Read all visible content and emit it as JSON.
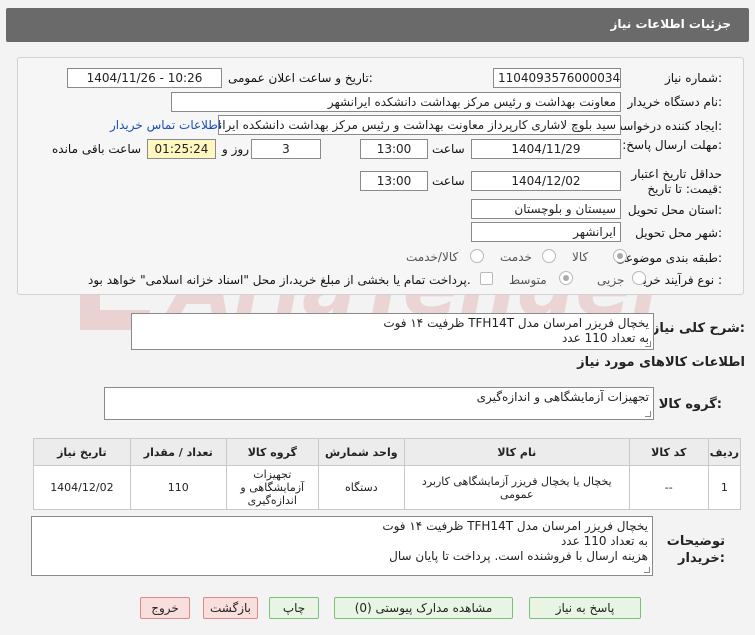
{
  "header": {
    "title": "جزئیات اطلاعات نیاز"
  },
  "form": {
    "need_number_label": "شماره نیاز:",
    "need_number": "1104093576000034",
    "announce_label": "تاریخ و ساعت اعلان عمومی:",
    "announce_value": "1404/11/26 - 10:26",
    "buyer_org_label": "نام دستگاه خریدار:",
    "buyer_org": "معاونت بهداشت و رئیس مرکز بهداشت دانشکده ایرانشهر",
    "creator_label": "ایجاد کننده درخواست:",
    "creator": "سید بلوچ لاشاری کارپرداز معاونت بهداشت و رئیس مرکز بهداشت دانشکده ایرانشهر",
    "contact_link": "اطلاعات تماس خریدار",
    "deadline_label": "مهلت ارسال پاسخ: تا تاریخ:",
    "deadline_date": "1404/11/29",
    "time_label": "ساعت",
    "deadline_time": "13:00",
    "days_value": "3",
    "days_label": "روز و",
    "remaining_time": "01:25:24",
    "remaining_label": "ساعت باقی مانده",
    "min_validity_label": "حداقل تاریخ اعتبار قیمت: تا تاریخ:",
    "validity_date": "1404/12/02",
    "validity_time": "13:00",
    "province_label": "استان محل تحویل:",
    "province": "سیستان و بلوچستان",
    "city_label": "شهر محل تحویل:",
    "city": "ایرانشهر",
    "category_label": "طبقه بندی موضوعی:",
    "category_options": [
      "کالا",
      "خدمت",
      "کالا/خدمت"
    ],
    "process_label": "نوع فرآیند خرید :",
    "process_options": [
      "جزیی",
      "متوسط"
    ],
    "payment_note": "پرداخت تمام یا بخشی از مبلغ خرید،از محل \"اسناد خزانه اسلامی\" خواهد بود."
  },
  "description": {
    "label": "شرح کلی نیاز:",
    "text": "یخچال فریزر امرسان مدل TFH14T ظرفیت ۱۴ فوت\nبه تعداد 110 عدد"
  },
  "goods_info_title": "اطلاعات کالاهای مورد نیاز",
  "goods_group": {
    "label": "گروه کالا:",
    "value": "تجهیزات آزمایشگاهی و اندازه‌گیری"
  },
  "table": {
    "headers": [
      "ردیف",
      "کد کالا",
      "نام کالا",
      "واحد شمارش",
      "گروه کالا",
      "تعداد / مقدار",
      "تاریخ نیاز"
    ],
    "rows": [
      {
        "row": "1",
        "code": "--",
        "name": "یخچال یا یخچال فریزر آزمایشگاهی کاربرد عمومی",
        "unit": "دستگاه",
        "group": "تجهیزات آزمایشگاهی و اندازه‌گیری",
        "qty": "110",
        "date": "1404/12/02"
      }
    ]
  },
  "buyer_notes": {
    "label": "توضیحات خریدار:",
    "text": "یخچال فریزر امرسان مدل TFH14T ظرفیت ۱۴ فوت\nبه تعداد 110 عدد\nهزینه ارسال با فروشنده است. پرداخت تا پایان سال"
  },
  "buttons": {
    "reply": "پاسخ به نیاز",
    "attachments": "مشاهده مدارک پیوستی (0)",
    "print": "چاپ",
    "back": "بازگشت",
    "exit": "خروج"
  },
  "watermark": {
    "text": "AriaTender.net"
  },
  "colors": {
    "header_bg": "#6a6a6a",
    "link": "#1a4fb5",
    "time_highlight": "#fff7c0"
  }
}
